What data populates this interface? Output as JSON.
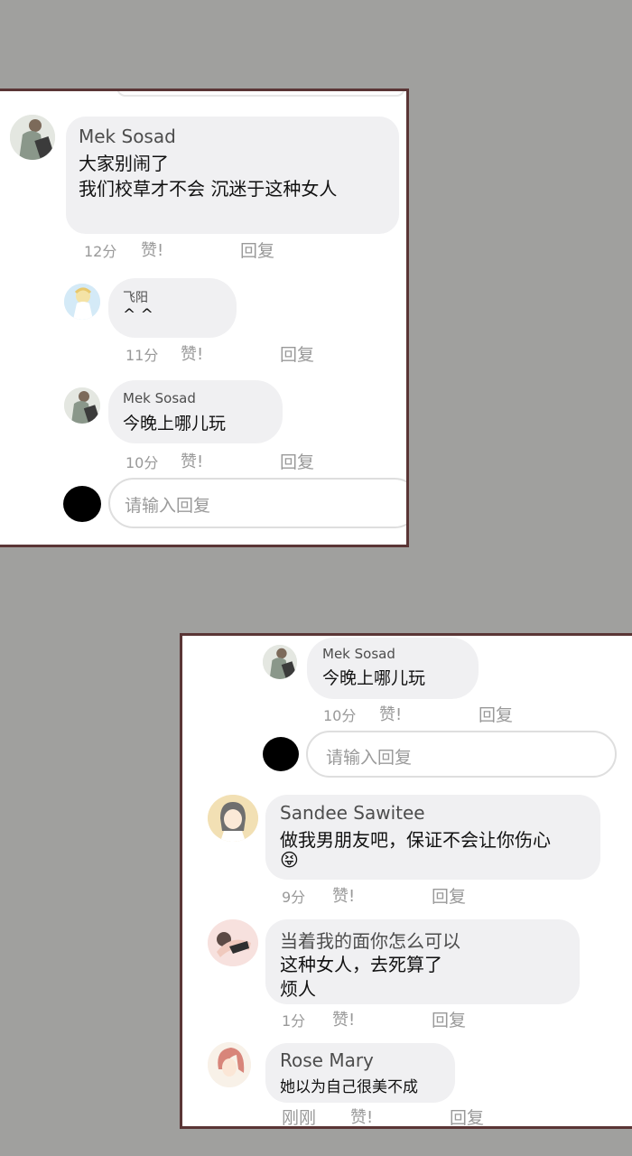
{
  "panel1": {
    "top_comment": {
      "name": "Mek Sosad",
      "line1": "大家别闹了",
      "line2": "我们校草才不会 沉迷于这种女人",
      "time": "12分",
      "like": "赞!",
      "reply": "回复"
    },
    "replies": [
      {
        "name": "飞阳",
        "text": "^ ^",
        "time": "11分",
        "like": "赞!",
        "reply": "回复"
      },
      {
        "name": "Mek Sosad",
        "text": "今晚上哪儿玩",
        "time": "10分",
        "like": "赞!",
        "reply": "回复"
      }
    ],
    "reply_input": {
      "placeholder": "请输入回复"
    }
  },
  "panel2": {
    "reply_top": {
      "name": "Mek Sosad",
      "text": "今晚上哪儿玩",
      "time": "10分",
      "like": "赞!",
      "reply": "回复"
    },
    "reply_input": {
      "placeholder": "请输入回复"
    },
    "comments": [
      {
        "name": "Sandee Sawitee",
        "line1": "做我男朋友吧，保证不会让你伤心",
        "emoji": "😝",
        "time": "9分",
        "like": "赞!",
        "reply": "回复"
      },
      {
        "name": "当着我的面你怎么可以",
        "line1": "这种女人，去死算了",
        "line2": "烦人",
        "time": "1分",
        "like": "赞!",
        "reply": "回复"
      },
      {
        "name": "Rose Mary",
        "line1": "她以为自己很美不成",
        "time": "刚刚",
        "like": "赞!",
        "reply": "回复"
      }
    ]
  },
  "colors": {
    "background": "#a0a09e",
    "bubble": "#f0f0f2",
    "frame": "#5a3535"
  }
}
